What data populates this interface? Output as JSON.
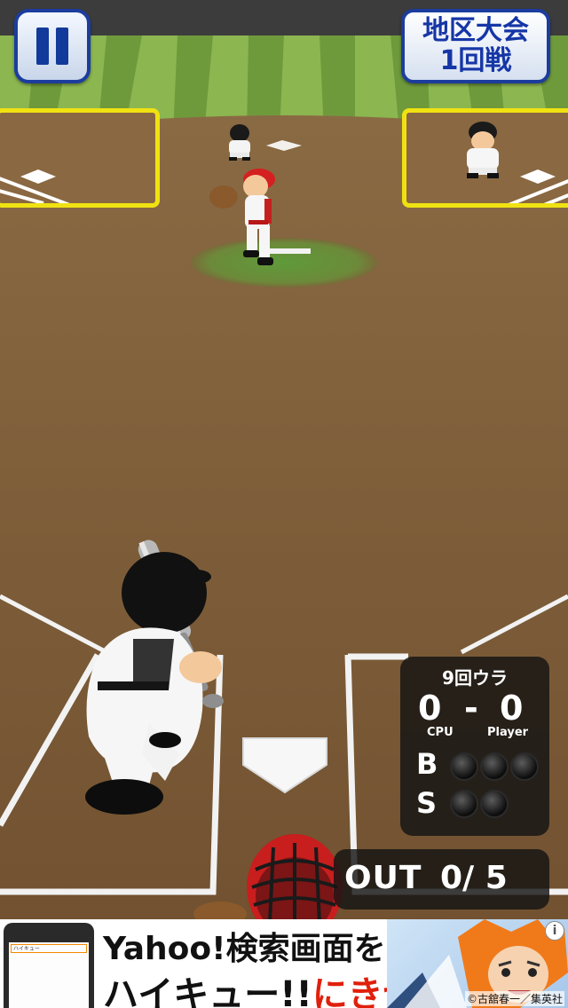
{
  "hud": {
    "pause_icon": "pause-icon",
    "round_line1": "地区大会",
    "round_line2": "1回戦"
  },
  "scoreboard": {
    "inning": "9回ウラ",
    "cpu_score": "0",
    "dash": "-",
    "player_score": "0",
    "cpu_label": "CPU",
    "player_label": "Player",
    "ball_label": "B",
    "strike_label": "S",
    "balls": 0,
    "strikes": 0,
    "ball_lamps": 3,
    "strike_lamps": 2
  },
  "outs": {
    "label": "OUT",
    "count": "0/ 5",
    "current": 0,
    "target": 5
  },
  "ad": {
    "line1_a": "Yahoo!",
    "line1_b": "検索画面を",
    "line2_a": "ハイキュー!!",
    "line2_b": "にきせかえ!",
    "credit": "©古舘春一／集英社",
    "info_icon": "info-icon",
    "phone_search_text": "ハイキュー"
  },
  "colors": {
    "dirt": "#7a5a36",
    "grass": "#6f9a3c",
    "panel": "#1c3d9e",
    "highlight": "#f0e212",
    "ad_red": "#e0200c"
  }
}
